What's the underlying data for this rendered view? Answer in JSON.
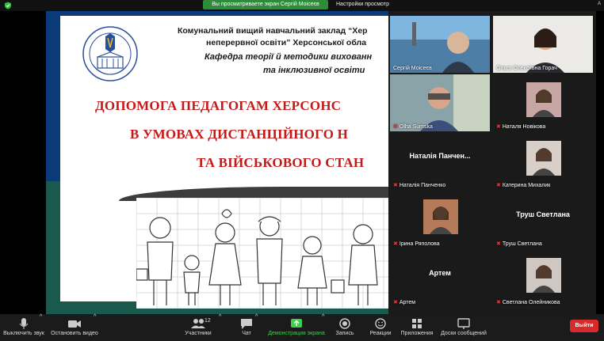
{
  "topbar": {
    "share_notice": "Вы просматриваете экран Сергій Моісеєв",
    "share_settings": "Настройки просмотр",
    "right_label": "A"
  },
  "slide": {
    "line1": "Комунальний вищий навчальний заклад “Хер",
    "line2": "неперервної освіти” Херсонської обла",
    "line3": "Кафедра теорії й методики вихованн",
    "line4": "та інклюзивної освіти",
    "title1": "ДОПОМОГА ПЕДАГОГАМ ХЕРСОНС",
    "title2": "В УМОВАХ ДИСТАНЦІЙНОГО Н",
    "title3": "ТА ВІЙСЬКОВОГО СТАН"
  },
  "participants": [
    {
      "name": "Сергій Моісеєв",
      "kind": "video",
      "active": true
    },
    {
      "name": "Ольга Олексіївна Горач",
      "kind": "video"
    },
    {
      "name": "Olha Sumska",
      "kind": "video",
      "muted": true
    },
    {
      "name": "Наталя Новікова",
      "kind": "photo",
      "muted": true
    },
    {
      "name": "Наталія Панченко",
      "center": "Наталія Панчен...",
      "kind": "text",
      "muted": true
    },
    {
      "name": "Катерина Михалик",
      "kind": "photo",
      "muted": true
    },
    {
      "name": "Ірина Ряполова",
      "kind": "photo",
      "muted": true
    },
    {
      "name": "Труш Светлана",
      "center": "Труш Светлана",
      "kind": "text",
      "muted": true
    },
    {
      "name": "Артем",
      "center": "Артем",
      "kind": "text",
      "muted": true
    },
    {
      "name": "Светлана Олейникова",
      "kind": "photo",
      "muted": true
    }
  ],
  "toolbar": {
    "audio": "Выключить звук",
    "video": "Остановить видео",
    "participants": "Участники",
    "participant_count": "12",
    "chat": "Чат",
    "share": "Демонстрация экрана",
    "record": "Запись",
    "reactions": "Реакции",
    "apps": "Приложения",
    "whiteboard": "Доски сообщений",
    "end": "Выйти"
  },
  "colors": {
    "accent_green": "#2fbf3c",
    "end_red": "#d52b2b",
    "slide_title_red": "#c41919",
    "slide_blue": "#0a3a7a"
  }
}
